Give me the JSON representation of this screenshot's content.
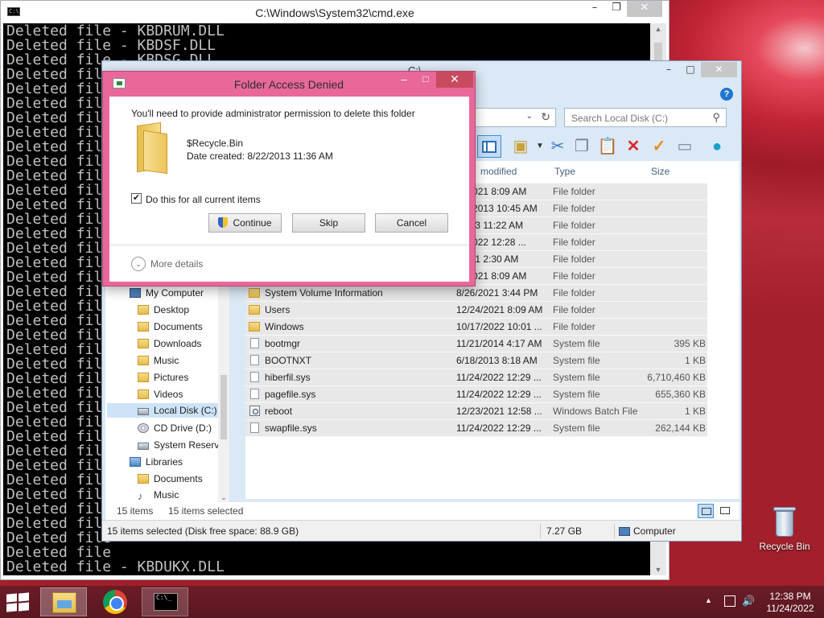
{
  "cmd": {
    "title": "C:\\Windows\\System32\\cmd.exe",
    "icon_label": "C:\\",
    "lines": [
      "Deleted file - KBDRUM.DLL",
      "Deleted file - KBDSF.DLL",
      "Deleted file - KBDSG.DLL",
      "Deleted file",
      "Deleted file",
      "Deleted file",
      "Deleted file",
      "Deleted file",
      "Deleted file",
      "Deleted file",
      "Deleted file",
      "Deleted file",
      "Deleted file",
      "Deleted file",
      "Deleted file",
      "Deleted file",
      "Deleted file",
      "Deleted file",
      "Deleted file",
      "Deleted file",
      "Deleted file",
      "Deleted file",
      "Deleted file",
      "Deleted file",
      "Deleted file",
      "Deleted file",
      "Deleted file",
      "Deleted file",
      "Deleted file",
      "Deleted file",
      "Deleted file",
      "Deleted file",
      "Deleted file",
      "Deleted file",
      "Deleted file",
      "Deleted file",
      "Deleted file",
      "Deleted file - KBDUKX.DLL"
    ]
  },
  "explorer": {
    "title": "C:\\",
    "search_placeholder": "Search Local Disk (C:)",
    "columns": {
      "date": "modified",
      "type": "Type",
      "size": "Size"
    },
    "files": [
      {
        "name": "",
        "date": "/4/2021 8:09 AM",
        "type": "File folder",
        "size": "",
        "icon": "folder"
      },
      {
        "name": "",
        "date": "/26/2013 10:45 AM",
        "type": "File folder",
        "size": "",
        "icon": "folder"
      },
      {
        "name": "",
        "date": "/2013 11:22 AM",
        "type": "File folder",
        "size": "",
        "icon": "folder"
      },
      {
        "name": "",
        "date": "/4/2022 12:28 ...",
        "type": "File folder",
        "size": "",
        "icon": "folder"
      },
      {
        "name": "",
        "date": "/2021 2:30 AM",
        "type": "File folder",
        "size": "",
        "icon": "folder"
      },
      {
        "name": "",
        "date": "/4/2021 8:09 AM",
        "type": "File folder",
        "size": "",
        "icon": "folder"
      },
      {
        "name": "System Volume Information",
        "date": "8/26/2021 3:44 PM",
        "type": "File folder",
        "size": "",
        "icon": "folder"
      },
      {
        "name": "Users",
        "date": "12/24/2021 8:09 AM",
        "type": "File folder",
        "size": "",
        "icon": "folder"
      },
      {
        "name": "Windows",
        "date": "10/17/2022 10:01 ...",
        "type": "File folder",
        "size": "",
        "icon": "folder"
      },
      {
        "name": "bootmgr",
        "date": "11/21/2014 4:17 AM",
        "type": "System file",
        "size": "395 KB",
        "icon": "file"
      },
      {
        "name": "BOOTNXT",
        "date": "6/18/2013 8:18 AM",
        "type": "System file",
        "size": "1 KB",
        "icon": "file"
      },
      {
        "name": "hiberfil.sys",
        "date": "11/24/2022 12:29 ...",
        "type": "System file",
        "size": "6,710,460 KB",
        "icon": "file"
      },
      {
        "name": "pagefile.sys",
        "date": "11/24/2022 12:29 ...",
        "type": "System file",
        "size": "655,360 KB",
        "icon": "file"
      },
      {
        "name": "reboot",
        "date": "12/23/2021 12:58 ...",
        "type": "Windows Batch File",
        "size": "1 KB",
        "icon": "bat"
      },
      {
        "name": "swapfile.sys",
        "date": "11/24/2022 12:29 ...",
        "type": "System file",
        "size": "262,144 KB",
        "icon": "file"
      }
    ],
    "nav": {
      "my_computer": "My Computer",
      "desktop": "Desktop",
      "documents": "Documents",
      "downloads": "Downloads",
      "music": "Music",
      "pictures": "Pictures",
      "videos": "Videos",
      "local_disk": "Local Disk (C:)",
      "cd_drive": "CD Drive (D:)",
      "system_reserved": "System Reserve",
      "libraries": "Libraries",
      "lib_documents": "Documents",
      "lib_music": "Music"
    },
    "item_count": "15 items",
    "selected_count": "15 items selected",
    "status_left": "15 items selected (Disk free space: 88.9 GB)",
    "status_size": "7.27 GB",
    "status_location": "Computer"
  },
  "dialog": {
    "title": "Folder Access Denied",
    "message": "You'll need to provide administrator permission to delete this folder",
    "folder_name": "$Recycle.Bin",
    "date_created": "Date created: 8/22/2013 11:36 AM",
    "checkbox_label": "Do this for all current items",
    "checkbox_checked": true,
    "continue_label": "Continue",
    "skip_label": "Skip",
    "cancel_label": "Cancel",
    "more_details": "More details"
  },
  "desktop": {
    "recycle_bin_label": "Recycle Bin"
  },
  "taskbar": {
    "cmd_icon_label": "C:\\_",
    "time": "12:38 PM",
    "date": "11/24/2022"
  }
}
